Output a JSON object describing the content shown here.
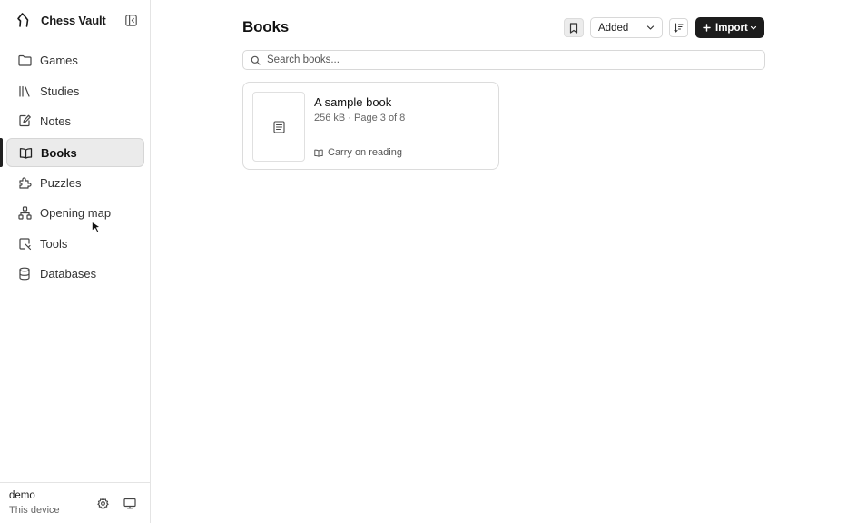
{
  "app": {
    "name": "Chess Vault"
  },
  "sidebar": {
    "items": [
      {
        "label": "Games",
        "icon": "folder-icon"
      },
      {
        "label": "Studies",
        "icon": "library-icon"
      },
      {
        "label": "Notes",
        "icon": "notebook-pen-icon"
      },
      {
        "label": "Books",
        "icon": "book-open-icon"
      },
      {
        "label": "Puzzles",
        "icon": "puzzle-icon"
      },
      {
        "label": "Opening map",
        "icon": "network-icon"
      },
      {
        "label": "Tools",
        "icon": "tool-icon"
      },
      {
        "label": "Databases",
        "icon": "database-icon"
      }
    ],
    "active": "Books"
  },
  "footer": {
    "user": "demo",
    "device": "This device"
  },
  "page": {
    "title": "Books"
  },
  "toolbar": {
    "sort_value": "Added",
    "import_label": "Import"
  },
  "search": {
    "placeholder": "Search books...",
    "value": ""
  },
  "books": [
    {
      "title": "A sample book",
      "meta": "256 kB · Page 3 of 8",
      "action": "Carry on reading"
    }
  ],
  "colors": {
    "accent": "#1c1c1c",
    "active_bg": "#ebebeb",
    "border": "#dcdcdc"
  }
}
